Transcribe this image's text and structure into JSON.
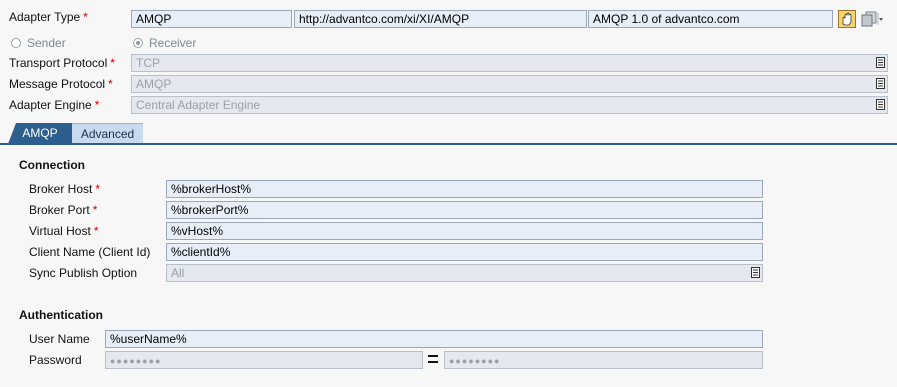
{
  "header": {
    "adapter_type_label": "Adapter Type",
    "adapter_name": "AMQP",
    "adapter_namespace": "http://advantco.com/xi/XI/AMQP",
    "adapter_swcv": "AMQP 1.0 of advantco.com",
    "sender_label": "Sender",
    "receiver_label": "Receiver",
    "selected_direction": "Receiver",
    "transport_protocol_label": "Transport Protocol",
    "transport_protocol_value": "TCP",
    "message_protocol_label": "Message Protocol",
    "message_protocol_value": "AMQP",
    "adapter_engine_label": "Adapter Engine",
    "adapter_engine_value": "Central Adapter Engine",
    "required_marker": "*"
  },
  "tabs": [
    {
      "label": "AMQP",
      "active": true
    },
    {
      "label": "Advanced",
      "active": false
    }
  ],
  "connection": {
    "title": "Connection",
    "broker_host_label": "Broker Host",
    "broker_host_value": "%brokerHost%",
    "broker_port_label": "Broker Port",
    "broker_port_value": "%brokerPort%",
    "virtual_host_label": "Virtual Host",
    "virtual_host_value": "%vHost%",
    "client_name_label": "Client Name (Client Id)",
    "client_name_value": "%clientId%",
    "sync_publish_label": "Sync Publish Option",
    "sync_publish_value": "All"
  },
  "authentication": {
    "title": "Authentication",
    "user_name_label": "User Name",
    "user_name_value": "%userName%",
    "password_label": "Password",
    "password_mask": "●●●●●●●●",
    "password_confirm_mask": "●●●●●●●●"
  },
  "colors": {
    "tab_active": "#2c5f8e",
    "tab_inactive": "#c8daf0",
    "field_bg": "#e8eef7",
    "required": "#d00000"
  },
  "icons": [
    "select-list-icon",
    "hand-icon",
    "copy-icon",
    "equals-icon"
  ]
}
